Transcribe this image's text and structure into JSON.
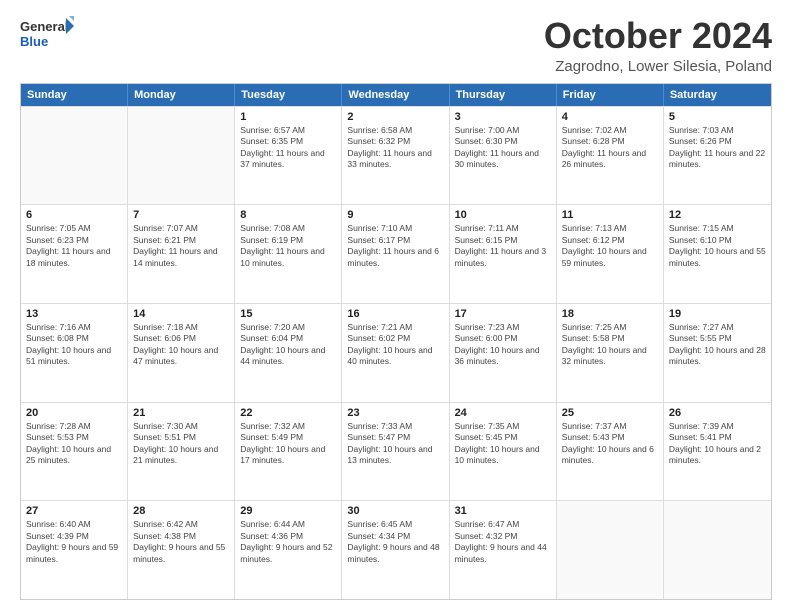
{
  "header": {
    "logo_line1": "General",
    "logo_line2": "Blue",
    "title": "October 2024",
    "subtitle": "Zagrodno, Lower Silesia, Poland"
  },
  "weekdays": [
    "Sunday",
    "Monday",
    "Tuesday",
    "Wednesday",
    "Thursday",
    "Friday",
    "Saturday"
  ],
  "rows": [
    [
      {
        "day": "",
        "sunrise": "",
        "sunset": "",
        "daylight": ""
      },
      {
        "day": "",
        "sunrise": "",
        "sunset": "",
        "daylight": ""
      },
      {
        "day": "1",
        "sunrise": "Sunrise: 6:57 AM",
        "sunset": "Sunset: 6:35 PM",
        "daylight": "Daylight: 11 hours and 37 minutes."
      },
      {
        "day": "2",
        "sunrise": "Sunrise: 6:58 AM",
        "sunset": "Sunset: 6:32 PM",
        "daylight": "Daylight: 11 hours and 33 minutes."
      },
      {
        "day": "3",
        "sunrise": "Sunrise: 7:00 AM",
        "sunset": "Sunset: 6:30 PM",
        "daylight": "Daylight: 11 hours and 30 minutes."
      },
      {
        "day": "4",
        "sunrise": "Sunrise: 7:02 AM",
        "sunset": "Sunset: 6:28 PM",
        "daylight": "Daylight: 11 hours and 26 minutes."
      },
      {
        "day": "5",
        "sunrise": "Sunrise: 7:03 AM",
        "sunset": "Sunset: 6:26 PM",
        "daylight": "Daylight: 11 hours and 22 minutes."
      }
    ],
    [
      {
        "day": "6",
        "sunrise": "Sunrise: 7:05 AM",
        "sunset": "Sunset: 6:23 PM",
        "daylight": "Daylight: 11 hours and 18 minutes."
      },
      {
        "day": "7",
        "sunrise": "Sunrise: 7:07 AM",
        "sunset": "Sunset: 6:21 PM",
        "daylight": "Daylight: 11 hours and 14 minutes."
      },
      {
        "day": "8",
        "sunrise": "Sunrise: 7:08 AM",
        "sunset": "Sunset: 6:19 PM",
        "daylight": "Daylight: 11 hours and 10 minutes."
      },
      {
        "day": "9",
        "sunrise": "Sunrise: 7:10 AM",
        "sunset": "Sunset: 6:17 PM",
        "daylight": "Daylight: 11 hours and 6 minutes."
      },
      {
        "day": "10",
        "sunrise": "Sunrise: 7:11 AM",
        "sunset": "Sunset: 6:15 PM",
        "daylight": "Daylight: 11 hours and 3 minutes."
      },
      {
        "day": "11",
        "sunrise": "Sunrise: 7:13 AM",
        "sunset": "Sunset: 6:12 PM",
        "daylight": "Daylight: 10 hours and 59 minutes."
      },
      {
        "day": "12",
        "sunrise": "Sunrise: 7:15 AM",
        "sunset": "Sunset: 6:10 PM",
        "daylight": "Daylight: 10 hours and 55 minutes."
      }
    ],
    [
      {
        "day": "13",
        "sunrise": "Sunrise: 7:16 AM",
        "sunset": "Sunset: 6:08 PM",
        "daylight": "Daylight: 10 hours and 51 minutes."
      },
      {
        "day": "14",
        "sunrise": "Sunrise: 7:18 AM",
        "sunset": "Sunset: 6:06 PM",
        "daylight": "Daylight: 10 hours and 47 minutes."
      },
      {
        "day": "15",
        "sunrise": "Sunrise: 7:20 AM",
        "sunset": "Sunset: 6:04 PM",
        "daylight": "Daylight: 10 hours and 44 minutes."
      },
      {
        "day": "16",
        "sunrise": "Sunrise: 7:21 AM",
        "sunset": "Sunset: 6:02 PM",
        "daylight": "Daylight: 10 hours and 40 minutes."
      },
      {
        "day": "17",
        "sunrise": "Sunrise: 7:23 AM",
        "sunset": "Sunset: 6:00 PM",
        "daylight": "Daylight: 10 hours and 36 minutes."
      },
      {
        "day": "18",
        "sunrise": "Sunrise: 7:25 AM",
        "sunset": "Sunset: 5:58 PM",
        "daylight": "Daylight: 10 hours and 32 minutes."
      },
      {
        "day": "19",
        "sunrise": "Sunrise: 7:27 AM",
        "sunset": "Sunset: 5:55 PM",
        "daylight": "Daylight: 10 hours and 28 minutes."
      }
    ],
    [
      {
        "day": "20",
        "sunrise": "Sunrise: 7:28 AM",
        "sunset": "Sunset: 5:53 PM",
        "daylight": "Daylight: 10 hours and 25 minutes."
      },
      {
        "day": "21",
        "sunrise": "Sunrise: 7:30 AM",
        "sunset": "Sunset: 5:51 PM",
        "daylight": "Daylight: 10 hours and 21 minutes."
      },
      {
        "day": "22",
        "sunrise": "Sunrise: 7:32 AM",
        "sunset": "Sunset: 5:49 PM",
        "daylight": "Daylight: 10 hours and 17 minutes."
      },
      {
        "day": "23",
        "sunrise": "Sunrise: 7:33 AM",
        "sunset": "Sunset: 5:47 PM",
        "daylight": "Daylight: 10 hours and 13 minutes."
      },
      {
        "day": "24",
        "sunrise": "Sunrise: 7:35 AM",
        "sunset": "Sunset: 5:45 PM",
        "daylight": "Daylight: 10 hours and 10 minutes."
      },
      {
        "day": "25",
        "sunrise": "Sunrise: 7:37 AM",
        "sunset": "Sunset: 5:43 PM",
        "daylight": "Daylight: 10 hours and 6 minutes."
      },
      {
        "day": "26",
        "sunrise": "Sunrise: 7:39 AM",
        "sunset": "Sunset: 5:41 PM",
        "daylight": "Daylight: 10 hours and 2 minutes."
      }
    ],
    [
      {
        "day": "27",
        "sunrise": "Sunrise: 6:40 AM",
        "sunset": "Sunset: 4:39 PM",
        "daylight": "Daylight: 9 hours and 59 minutes."
      },
      {
        "day": "28",
        "sunrise": "Sunrise: 6:42 AM",
        "sunset": "Sunset: 4:38 PM",
        "daylight": "Daylight: 9 hours and 55 minutes."
      },
      {
        "day": "29",
        "sunrise": "Sunrise: 6:44 AM",
        "sunset": "Sunset: 4:36 PM",
        "daylight": "Daylight: 9 hours and 52 minutes."
      },
      {
        "day": "30",
        "sunrise": "Sunrise: 6:45 AM",
        "sunset": "Sunset: 4:34 PM",
        "daylight": "Daylight: 9 hours and 48 minutes."
      },
      {
        "day": "31",
        "sunrise": "Sunrise: 6:47 AM",
        "sunset": "Sunset: 4:32 PM",
        "daylight": "Daylight: 9 hours and 44 minutes."
      },
      {
        "day": "",
        "sunrise": "",
        "sunset": "",
        "daylight": ""
      },
      {
        "day": "",
        "sunrise": "",
        "sunset": "",
        "daylight": ""
      }
    ]
  ]
}
